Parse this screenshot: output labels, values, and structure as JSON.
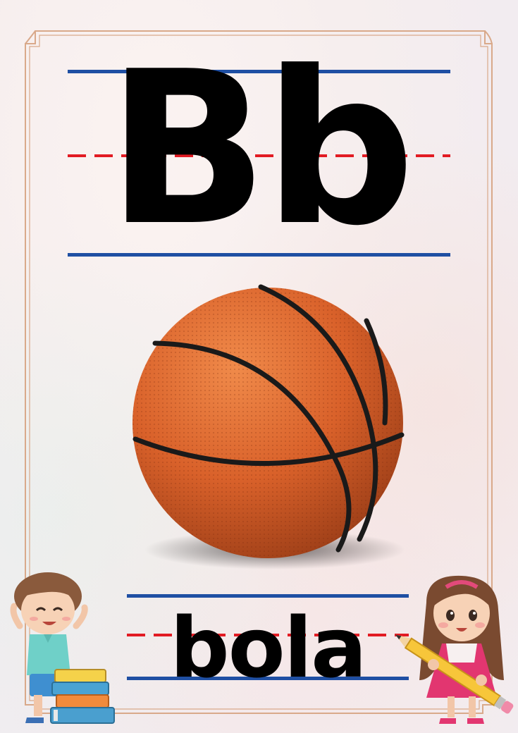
{
  "letter_pair": "Bb",
  "word": "bola",
  "picture": "basketball",
  "colors": {
    "guide_blue": "#1f4fa3",
    "guide_red": "#e21b23",
    "frame": "#d9a98a",
    "ball": "#e0662a",
    "text": "#000000"
  },
  "decorations": [
    "boy-with-books",
    "girl-with-pencil"
  ]
}
